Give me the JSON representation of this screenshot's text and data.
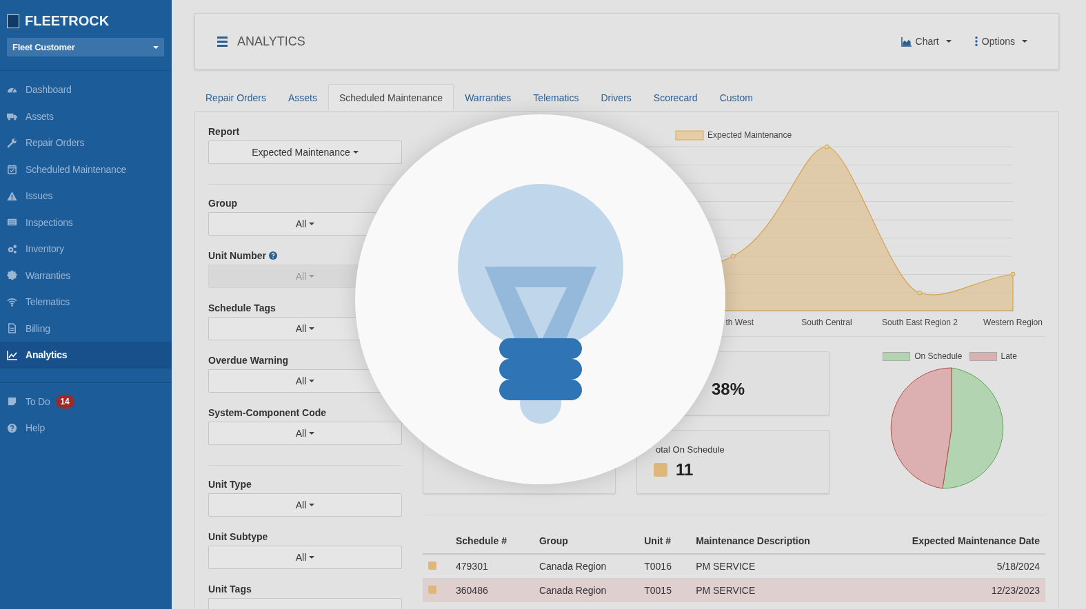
{
  "sidebar": {
    "brand": "FLEETROCK",
    "account": "Fleet Customer",
    "items": [
      {
        "label": "Dashboard",
        "selected": false
      },
      {
        "label": "Assets",
        "selected": false
      },
      {
        "label": "Repair Orders",
        "selected": false
      },
      {
        "label": "Scheduled Maintenance",
        "selected": false
      },
      {
        "label": "Issues",
        "selected": false
      },
      {
        "label": "Inspections",
        "selected": false
      },
      {
        "label": "Inventory",
        "selected": false
      },
      {
        "label": "Warranties",
        "selected": false
      },
      {
        "label": "Telematics",
        "selected": false
      },
      {
        "label": "Billing",
        "selected": false
      },
      {
        "label": "Analytics",
        "selected": true
      }
    ],
    "extra_items": [
      {
        "label": "To Do",
        "badge": "14"
      },
      {
        "label": "Help"
      }
    ]
  },
  "header": {
    "title": "ANALYTICS",
    "actions": [
      "Chart",
      "Options"
    ]
  },
  "tabs": [
    {
      "label": "Repair Orders",
      "selected": false
    },
    {
      "label": "Assets",
      "selected": false
    },
    {
      "label": "Scheduled Maintenance",
      "selected": true
    },
    {
      "label": "Warranties",
      "selected": false
    },
    {
      "label": "Telematics",
      "selected": false
    },
    {
      "label": "Drivers",
      "selected": false
    },
    {
      "label": "Scorecard",
      "selected": false
    },
    {
      "label": "Custom",
      "selected": false
    }
  ],
  "filter_sections": [
    {
      "filters": [
        {
          "kind": "plain",
          "label": "Report",
          "value": "Expected Maintenance",
          "disabled": false
        }
      ]
    },
    {
      "filters": [
        {
          "kind": "plain",
          "label": "Group",
          "value": "All",
          "disabled": false
        },
        {
          "kind": "help",
          "label": "Unit Number",
          "value": "All",
          "disabled": true
        },
        {
          "kind": "plain",
          "label": "Schedule Tags",
          "value": "All",
          "disabled": false
        },
        {
          "kind": "plain",
          "label": "Overdue Warning",
          "value": "All",
          "disabled": false
        },
        {
          "kind": "plain",
          "label": "System-Component Code",
          "value": "All",
          "disabled": false
        }
      ]
    },
    {
      "filters": [
        {
          "kind": "plain",
          "label": "Unit Type",
          "value": "All",
          "disabled": false
        },
        {
          "kind": "plain",
          "label": "Unit Subtype",
          "value": "All",
          "disabled": false
        },
        {
          "kind": "plain",
          "label": "Unit Tags",
          "disabled": false
        }
      ]
    }
  ],
  "chart": {
    "legend": "Expected Maintenance",
    "x_labels": [
      "th West",
      "South Central",
      "South East Region 2",
      "Western Region"
    ]
  },
  "stat_cards": [
    {
      "kind": "plain",
      "value": "38%"
    },
    {
      "kind": "swatch"
    },
    {
      "kind": "swatch",
      "label": "otal On Schedule",
      "value": "11"
    }
  ],
  "pie": {
    "legend": [
      {
        "label": "On Schedule",
        "color": "#b3d4b0"
      },
      {
        "label": "Late",
        "color": "#dcb0b0"
      }
    ]
  },
  "table": {
    "columns": [
      "Schedule #",
      "Group",
      "Unit #",
      "Maintenance Description",
      "Expected Maintenance Date"
    ],
    "rows": [
      {
        "cells": [
          "479301",
          "Canada Region",
          "T0016",
          "PM SERVICE",
          "5/18/2024"
        ],
        "late": false
      },
      {
        "cells": [
          "360486",
          "Canada Region",
          "T0015",
          "PM SERVICE",
          "12/23/2023"
        ],
        "late": true
      }
    ]
  }
}
